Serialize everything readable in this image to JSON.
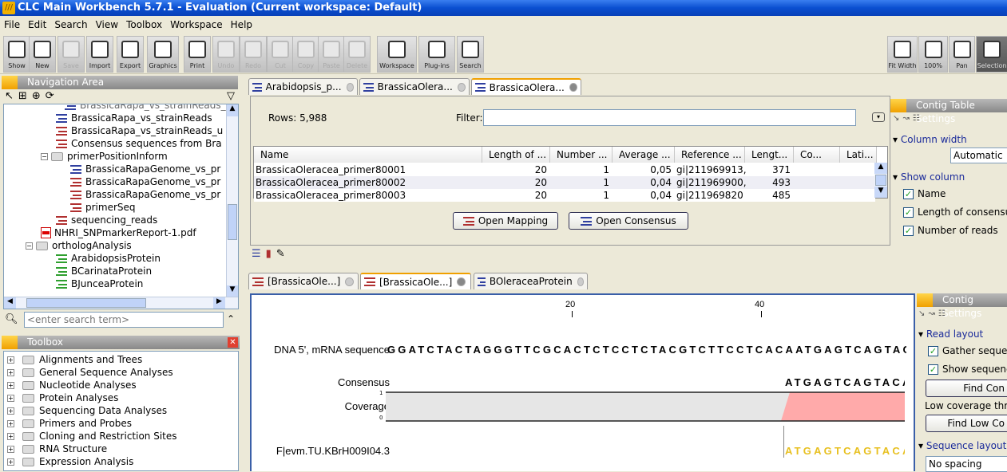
{
  "window": {
    "title": "CLC Main Workbench 5.7.1 - Evaluation  (Current workspace: Default)"
  },
  "menu": [
    "File",
    "Edit",
    "Search",
    "View",
    "Toolbox",
    "Workspace",
    "Help"
  ],
  "toolbar": [
    {
      "label": "Show",
      "enabled": true
    },
    {
      "label": "New",
      "enabled": true
    },
    {
      "label": "Save",
      "enabled": false
    },
    {
      "label": "Import",
      "enabled": true
    },
    {
      "label": "Export",
      "enabled": true
    },
    {
      "label": "Graphics",
      "enabled": true
    },
    {
      "label": "Print",
      "enabled": true
    },
    {
      "label": "Undo",
      "enabled": false
    },
    {
      "label": "Redo",
      "enabled": false
    },
    {
      "label": "Cut",
      "enabled": false
    },
    {
      "label": "Copy",
      "enabled": false
    },
    {
      "label": "Paste",
      "enabled": false
    },
    {
      "label": "Delete",
      "enabled": false
    },
    {
      "label": "Workspace",
      "enabled": true
    },
    {
      "label": "Plug-ins",
      "enabled": true
    },
    {
      "label": "Search",
      "enabled": true
    }
  ],
  "view_tools": [
    {
      "label": "Fit Width"
    },
    {
      "label": "100%"
    },
    {
      "label": "Pan"
    },
    {
      "label": "Selection",
      "selected": true
    }
  ],
  "navigation": {
    "title": "Navigation Area",
    "items": [
      {
        "label": "BrassicaRapa_vs_strainReads",
        "icon": "contig-table-icon",
        "indent": 3
      },
      {
        "label": "BrassicaRapa_vs_strainReads_u",
        "icon": "sequence-list-icon",
        "indent": 3
      },
      {
        "label": "Consensus sequences from Bra",
        "icon": "sequence-list-icon",
        "indent": 3
      },
      {
        "label": "primerPositionInform",
        "icon": "folder-icon",
        "indent": 2,
        "expanded": true
      },
      {
        "label": "BrassicaRapaGenome_vs_pr",
        "icon": "contig-table-icon",
        "indent": 4
      },
      {
        "label": "BrassicaRapaGenome_vs_pr",
        "icon": "sequence-list-icon",
        "indent": 4
      },
      {
        "label": "BrassicaRapaGenome_vs_pr",
        "icon": "sequence-list-icon",
        "indent": 4
      },
      {
        "label": "primerSeq",
        "icon": "sequence-list-icon",
        "indent": 4
      },
      {
        "label": "sequencing_reads",
        "icon": "sequence-list-icon",
        "indent": 3
      },
      {
        "label": "NHRI_SNPmarkerReport-1.pdf",
        "icon": "pdf-icon",
        "indent": 2
      },
      {
        "label": "orthologAnalysis",
        "icon": "folder-icon",
        "indent": 1,
        "expanded": true
      },
      {
        "label": "ArabidopsisProtein",
        "icon": "protein-list-icon",
        "indent": 3
      },
      {
        "label": "BCarinataProtein",
        "icon": "protein-list-icon",
        "indent": 3
      },
      {
        "label": "BJunceaProtein",
        "icon": "protein-list-icon",
        "indent": 3
      }
    ],
    "search_placeholder": "<enter search term>"
  },
  "toolbox": {
    "title": "Toolbox",
    "items": [
      "Alignments and Trees",
      "General Sequence Analyses",
      "Nucleotide Analyses",
      "Protein Analyses",
      "Sequencing Data Analyses",
      "Primers and Probes",
      "Cloning and Restriction Sites",
      "RNA Structure",
      "Expression Analysis"
    ]
  },
  "top_tabs": [
    {
      "label": "Arabidopsis_p...",
      "active": false
    },
    {
      "label": "BrassicaOlera...",
      "active": false
    },
    {
      "label": "BrassicaOlera...",
      "active": true
    }
  ],
  "table": {
    "rows_label": "Rows: 5,988",
    "filter_label": "Filter:",
    "filter_value": "",
    "columns": [
      "Name",
      "Length of ...",
      "Number ...",
      "Average ...",
      "Reference ...",
      "Lengt...",
      "Co...",
      "Lati..."
    ],
    "rows": [
      [
        "BrassicaOleracea_primer80001",
        "20",
        "1",
        "0,05",
        "gi|211969913,...",
        "371",
        "",
        ""
      ],
      [
        "BrassicaOleracea_primer80002",
        "20",
        "1",
        "0,04",
        "gi|211969900,...",
        "493",
        "",
        ""
      ],
      [
        "BrassicaOleracea_primer80003",
        "20",
        "1",
        "0,04",
        "gi|211969820",
        "485",
        "",
        ""
      ]
    ],
    "open_mapping": "Open Mapping",
    "open_consensus": "Open Consensus"
  },
  "table_settings": {
    "title": "Contig Table Settings",
    "column_width_section": "Column width",
    "column_width_value": "Automatic",
    "show_column_section": "Show column",
    "columns": [
      {
        "label": "Name",
        "checked": true
      },
      {
        "label": "Length of consensu",
        "checked": true
      },
      {
        "label": "Number of reads",
        "checked": true
      }
    ]
  },
  "bottom_tabs": [
    {
      "label": "[BrassicaOle...]",
      "active": false
    },
    {
      "label": "[BrassicaOle...]",
      "active": true
    },
    {
      "label": "BOleraceaProtein",
      "active": false
    }
  ],
  "contig_view": {
    "ruler": [
      "20",
      "40"
    ],
    "reference_label": "DNA 5', mRNA sequence",
    "reference_seq": "GGATCTACTAGGGTTCGCACTCTCCTCTACGTCTTCCTCACAATGAGTCAGTACA",
    "consensus_label": "Consensus",
    "consensus_seq": "ATGAGTCAGTACA",
    "coverage_label": "Coverage",
    "coverage_max": "1",
    "coverage_min": "0",
    "read_label": "F|evm.TU.KBrH009I04.3",
    "read_seq": "ATGAGTCAGTACA",
    "colors": {
      "coverage_low": "#e6e6e6",
      "coverage_high": "#ffaaaa",
      "read": "#e8c020"
    }
  },
  "contig_settings": {
    "title": "Contig Settings",
    "read_layout": "Read layout",
    "gather": "Gather sequen",
    "show_seq": "Show sequenc",
    "find_conflict": "Find Con",
    "low_cov": "Low coverage thre",
    "find_low": "Find Low Co",
    "sequence_layout": "Sequence layout",
    "spacing": "No spacing"
  }
}
